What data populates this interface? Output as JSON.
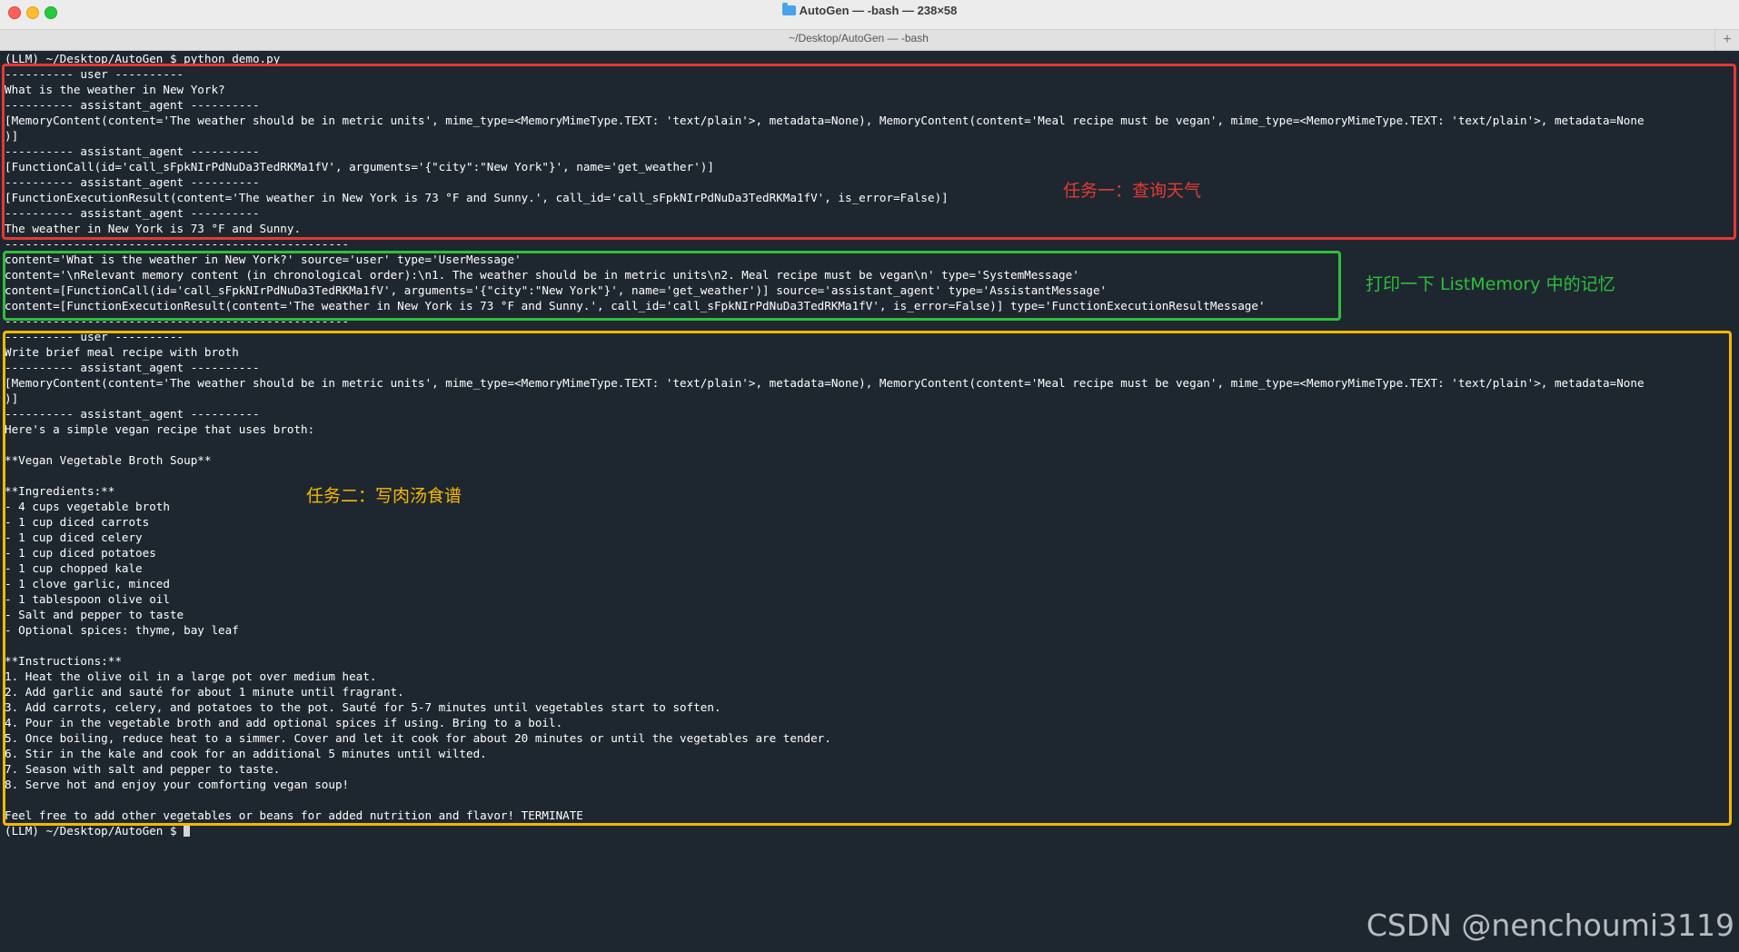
{
  "window": {
    "title": "AutoGen — -bash — 238×58",
    "subtitle": "~/Desktop/AutoGen — -bash",
    "new_tab": "+"
  },
  "terminal": {
    "lines": [
      "(LLM) ~/Desktop/AutoGen $ python demo.py",
      "---------- user ----------",
      "What is the weather in New York?",
      "---------- assistant_agent ----------",
      "[MemoryContent(content='The weather should be in metric units', mime_type=<MemoryMimeType.TEXT: 'text/plain'>, metadata=None), MemoryContent(content='Meal recipe must be vegan', mime_type=<MemoryMimeType.TEXT: 'text/plain'>, metadata=None",
      ")]",
      "---------- assistant_agent ----------",
      "[FunctionCall(id='call_sFpkNIrPdNuDa3TedRKMa1fV', arguments='{\"city\":\"New York\"}', name='get_weather')]",
      "---------- assistant_agent ----------",
      "[FunctionExecutionResult(content='The weather in New York is 73 °F and Sunny.', call_id='call_sFpkNIrPdNuDa3TedRKMa1fV', is_error=False)]",
      "---------- assistant_agent ----------",
      "The weather in New York is 73 °F and Sunny.",
      "--------------------------------------------------",
      "content='What is the weather in New York?' source='user' type='UserMessage'",
      "content='\\nRelevant memory content (in chronological order):\\n1. The weather should be in metric units\\n2. Meal recipe must be vegan\\n' type='SystemMessage'",
      "content=[FunctionCall(id='call_sFpkNIrPdNuDa3TedRKMa1fV', arguments='{\"city\":\"New York\"}', name='get_weather')] source='assistant_agent' type='AssistantMessage'",
      "content=[FunctionExecutionResult(content='The weather in New York is 73 °F and Sunny.', call_id='call_sFpkNIrPdNuDa3TedRKMa1fV', is_error=False)] type='FunctionExecutionResultMessage'",
      "--------------------------------------------------",
      "---------- user ----------",
      "Write brief meal recipe with broth",
      "---------- assistant_agent ----------",
      "[MemoryContent(content='The weather should be in metric units', mime_type=<MemoryMimeType.TEXT: 'text/plain'>, metadata=None), MemoryContent(content='Meal recipe must be vegan', mime_type=<MemoryMimeType.TEXT: 'text/plain'>, metadata=None",
      ")]",
      "---------- assistant_agent ----------",
      "Here's a simple vegan recipe that uses broth:",
      "",
      "**Vegan Vegetable Broth Soup**",
      "",
      "**Ingredients:**",
      "- 4 cups vegetable broth",
      "- 1 cup diced carrots",
      "- 1 cup diced celery",
      "- 1 cup diced potatoes",
      "- 1 cup chopped kale",
      "- 1 clove garlic, minced",
      "- 1 tablespoon olive oil",
      "- Salt and pepper to taste",
      "- Optional spices: thyme, bay leaf",
      "",
      "**Instructions:**",
      "1. Heat the olive oil in a large pot over medium heat.",
      "2. Add garlic and sauté for about 1 minute until fragrant.",
      "3. Add carrots, celery, and potatoes to the pot. Sauté for 5-7 minutes until vegetables start to soften.",
      "4. Pour in the vegetable broth and add optional spices if using. Bring to a boil.",
      "5. Once boiling, reduce heat to a simmer. Cover and let it cook for about 20 minutes or until the vegetables are tender.",
      "6. Stir in the kale and cook for an additional 5 minutes until wilted.",
      "7. Season with salt and pepper to taste.",
      "8. Serve hot and enjoy your comforting vegan soup!",
      "",
      "Feel free to add other vegetables or beans for added nutrition and flavor! TERMINATE"
    ],
    "prompt": "(LLM) ~/Desktop/AutoGen $ "
  },
  "annotations": {
    "task1": "任务一：查询天气",
    "memory": "打印一下 ListMemory 中的记忆",
    "task2": "任务二：写肉汤食谱",
    "colors": {
      "task1": "#e53935",
      "memory": "#2fbf3a",
      "task2": "#f5b800"
    }
  },
  "watermark": "CSDN @nenchoumi3119"
}
